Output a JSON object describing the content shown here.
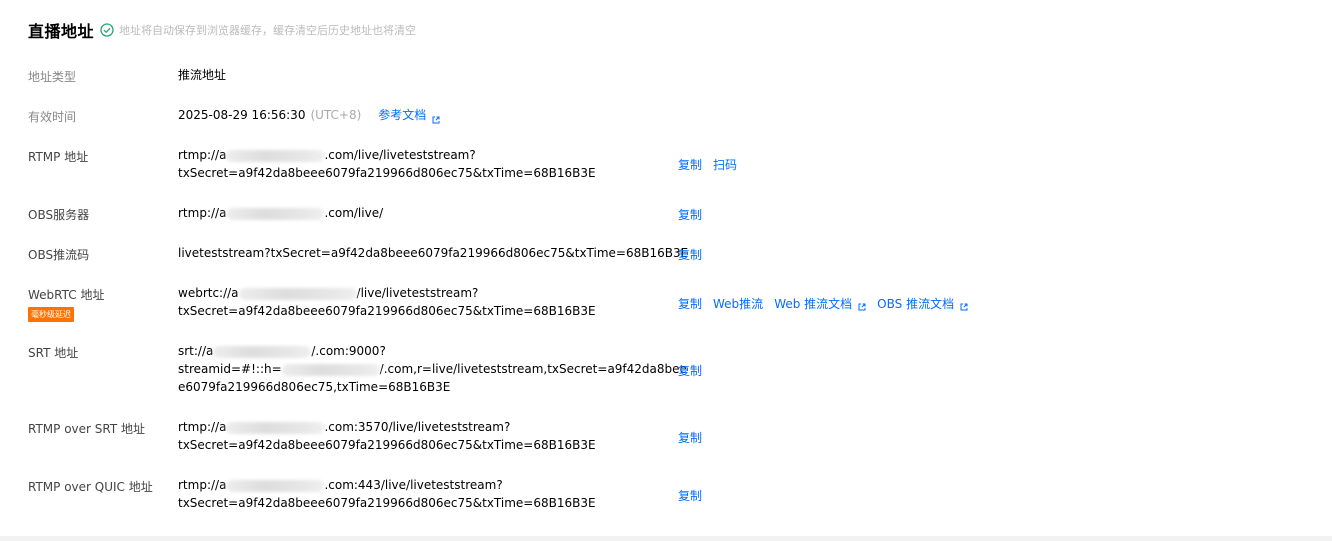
{
  "header": {
    "title": "直播地址",
    "hint": "地址将自动保存到浏览器缓存，缓存清空后历史地址也将清空"
  },
  "rows": {
    "address_type": {
      "label": "地址类型",
      "value": "推流地址"
    },
    "valid_time": {
      "label": "有效时间",
      "value": "2025-08-29 16:56:30",
      "timezone": "(UTC+8)",
      "doc_link": "参考文档"
    },
    "rtmp": {
      "label": "RTMP 地址",
      "line1_prefix": "rtmp://a",
      "line1_suffix": ".com/live/liveteststream?",
      "line2": "txSecret=a9f42da8beee6079fa219966d806ec75&txTime=68B16B3E",
      "copy": "复制",
      "scan": "扫码"
    },
    "obs_server": {
      "label": "OBS服务器",
      "line1_prefix": "rtmp://a",
      "line1_suffix": ".com/live/",
      "copy": "复制"
    },
    "obs_key": {
      "label": "OBS推流码",
      "value": "liveteststream?txSecret=a9f42da8beee6079fa219966d806ec75&txTime=68B16B3E",
      "copy": "复制"
    },
    "webrtc": {
      "label": "WebRTC 地址",
      "badge": "毫秒级延迟",
      "line1_prefix": "webrtc://a",
      "line1_suffix": "/live/liveteststream?",
      "line2": "txSecret=a9f42da8beee6079fa219966d806ec75&txTime=68B16B3E",
      "copy": "复制",
      "web_push": "Web推流",
      "web_push_doc": "Web 推流文档",
      "obs_push_doc": "OBS 推流文档"
    },
    "srt": {
      "label": "SRT 地址",
      "line1_prefix": "srt://a",
      "line1_suffix": "/.com:9000?",
      "line2_prefix": "streamid=#!::h=",
      "line2_suffix": "/.com,r=live/liveteststream,txSecret=a9f42da8bee",
      "line3": "e6079fa219966d806ec75,txTime=68B16B3E",
      "copy": "复制"
    },
    "rtmp_over_srt": {
      "label": "RTMP over SRT 地址",
      "line1_prefix": "rtmp://a",
      "line1_suffix": ".com:3570/live/liveteststream?",
      "line2": "txSecret=a9f42da8beee6079fa219966d806ec75&txTime=68B16B3E",
      "copy": "复制"
    },
    "rtmp_over_quic": {
      "label": "RTMP over QUIC 地址",
      "line1_prefix": "rtmp://a",
      "line1_suffix": ".com:443/live/liveteststream?",
      "line2": "txSecret=a9f42da8beee6079fa219966d806ec75&txTime=68B16B3E",
      "copy": "复制"
    }
  },
  "colors": {
    "link": "#006eff",
    "badge": "#ff7200",
    "check": "#2ba471",
    "hint": "#bbbbbb"
  },
  "icons": {
    "check": "check-circle-icon",
    "external": "external-link-icon"
  }
}
